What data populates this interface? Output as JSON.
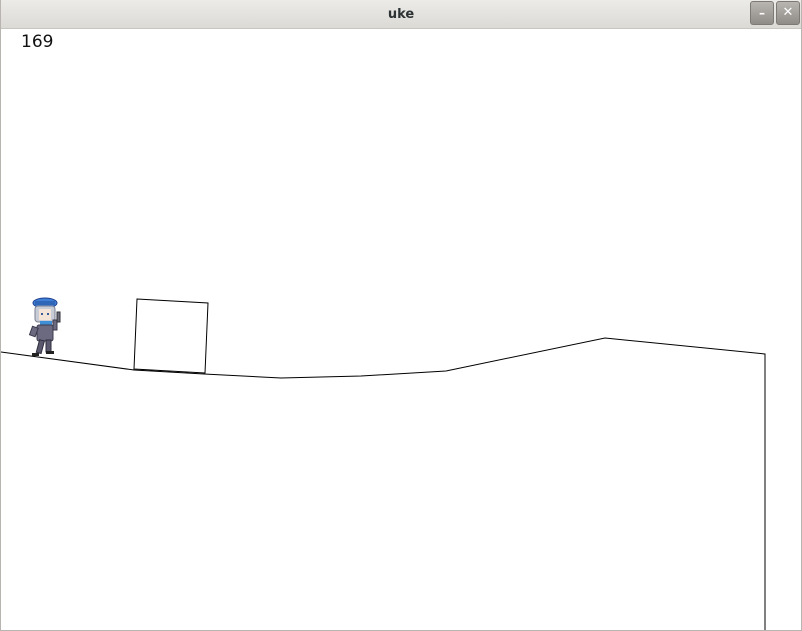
{
  "window": {
    "title": "uke",
    "minimize_label": "–",
    "close_label": "✕"
  },
  "game": {
    "score": "169",
    "player": {
      "hat_color": "#3f7fd6",
      "hair_color": "#c8ccd6",
      "suit_color": "#6b6a80",
      "scarf_color": "#3f8fd6",
      "weapon_color": "#6e6e7a"
    },
    "line_color": "#000000",
    "background_color": "#ffffff"
  }
}
